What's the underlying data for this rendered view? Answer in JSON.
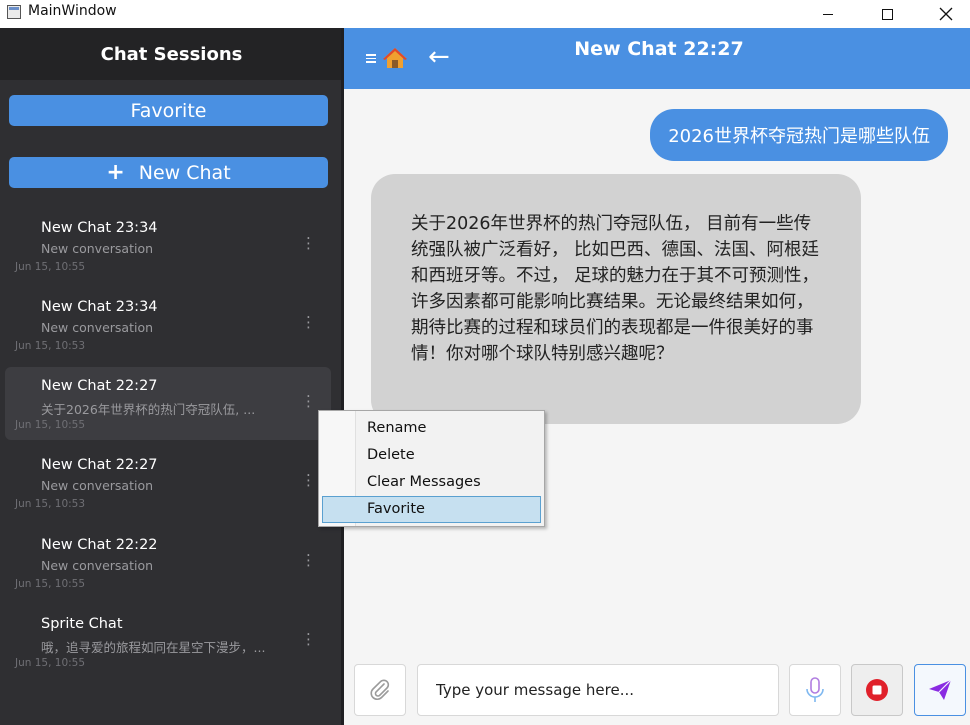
{
  "window": {
    "title": "MainWindow",
    "min_icon": "minimize-icon",
    "max_icon": "maximize-icon",
    "close_icon": "close-icon"
  },
  "sidebar": {
    "title": "Chat Sessions",
    "favorite_label": "Favorite",
    "new_chat_label": "New Chat",
    "new_chat_icon": "+",
    "sessions": [
      {
        "title": "New Chat 23:34",
        "subtitle": "New conversation",
        "time": "Jun 15, 10:55"
      },
      {
        "title": "New Chat 23:34",
        "subtitle": "New conversation",
        "time": "Jun 15, 10:53"
      },
      {
        "title": "New Chat 22:27",
        "subtitle": "关于2026年世界杯的热门夺冠队伍, ...",
        "time": "Jun 15, 10:55"
      },
      {
        "title": "New Chat 22:27",
        "subtitle": "New conversation",
        "time": "Jun 15, 10:53"
      },
      {
        "title": "New Chat 22:22",
        "subtitle": "New conversation",
        "time": "Jun 15, 10:55"
      },
      {
        "title": "Sprite Chat",
        "subtitle": "哦，追寻爱的旅程如同在星空下漫步，...",
        "time": "Jun 15, 10:55"
      }
    ],
    "more_glyph": "⋮"
  },
  "header": {
    "title": "New Chat 22:27",
    "back_glyph": "←"
  },
  "chat": {
    "user_message": "2026世界杯夺冠热门是哪些队伍",
    "bot_message": "关于2026年世界杯的热门夺冠队伍， 目前有一些传统强队被广泛看好， 比如巴西、德国、法国、阿根廷和西班牙等。不过， 足球的魅力在于其不可预测性， 许多因素都可能影响比赛结果。无论最终结果如何， 期待比赛的过程和球员们的表现都是一件很美好的事情！你对哪个球队特别感兴趣呢？"
  },
  "context_menu": {
    "items": [
      "Rename",
      "Delete",
      "Clear Messages",
      "Favorite"
    ],
    "selected": "Favorite"
  },
  "input": {
    "placeholder": "Type your message here...",
    "value": ""
  },
  "colors": {
    "accent": "#4a90e2",
    "sidebar_bg": "#2f2f32",
    "bot_bubble": "#d2d2d2",
    "stop_red": "#e0202a",
    "send_purple": "#8a2be2"
  }
}
